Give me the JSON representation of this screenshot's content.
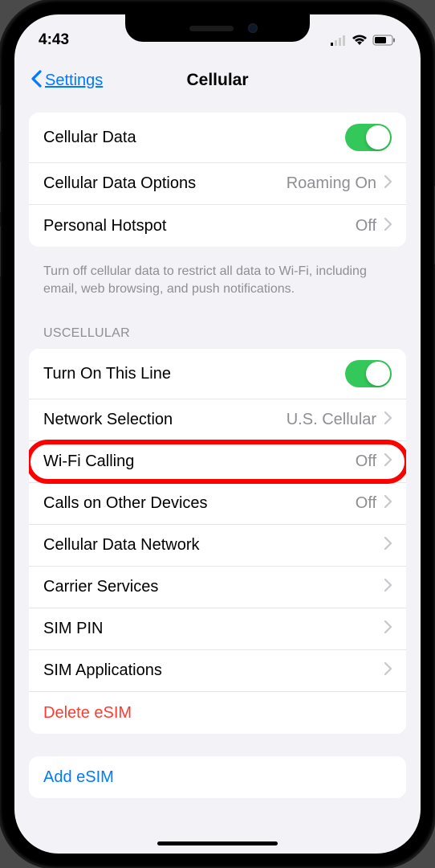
{
  "statusBar": {
    "time": "4:43"
  },
  "nav": {
    "backLabel": "Settings",
    "title": "Cellular"
  },
  "group1": {
    "cellularData": {
      "label": "Cellular Data",
      "toggle": "on"
    },
    "cellularDataOptions": {
      "label": "Cellular Data Options",
      "value": "Roaming On"
    },
    "personalHotspot": {
      "label": "Personal Hotspot",
      "value": "Off"
    },
    "footer": "Turn off cellular data to restrict all data to Wi-Fi, including email, web browsing, and push notifications."
  },
  "carrierHeader": "USCELLULAR",
  "group2": {
    "turnOnLine": {
      "label": "Turn On This Line",
      "toggle": "on"
    },
    "networkSelection": {
      "label": "Network Selection",
      "value": "U.S. Cellular"
    },
    "wifiCalling": {
      "label": "Wi-Fi Calling",
      "value": "Off"
    },
    "callsOtherDevices": {
      "label": "Calls on Other Devices",
      "value": "Off"
    },
    "cellularDataNetwork": {
      "label": "Cellular Data Network"
    },
    "carrierServices": {
      "label": "Carrier Services"
    },
    "simPin": {
      "label": "SIM PIN"
    },
    "simApplications": {
      "label": "SIM Applications"
    },
    "deleteEsim": {
      "label": "Delete eSIM"
    }
  },
  "group3": {
    "addEsim": {
      "label": "Add eSIM"
    }
  }
}
